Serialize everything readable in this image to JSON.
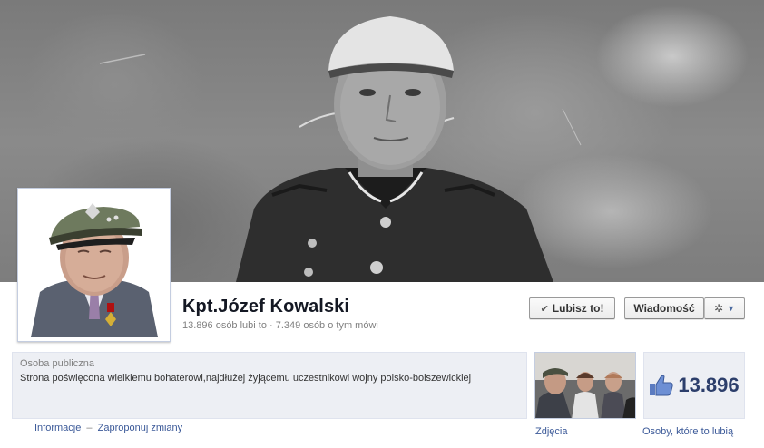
{
  "page": {
    "name": "Kpt.Józef Kowalski",
    "stats": "13.896 osób lubi to · 7.349 osób o tym mówi"
  },
  "actions": {
    "like_label": "Lubisz to!",
    "message_label": "Wiadomość"
  },
  "about": {
    "category": "Osoba publiczna",
    "description": "Strona poświęcona wielkiemu bohaterowi,najdłużej żyjącemu uczestnikowi wojny polsko-bolszewickiej",
    "info_link": "Informacje",
    "separator": "–",
    "suggest_link": "Zaproponuj zmiany"
  },
  "tiles": {
    "photos_label": "Zdjęcia",
    "likes_count": "13.896",
    "likes_label": "Osoby, które to lubią"
  },
  "icons": {
    "like": "thumbs-up-icon",
    "check": "checkmark-icon",
    "gear": "gear-icon",
    "caret": "caret-down-icon"
  },
  "colors": {
    "link": "#3b5998",
    "info_bg": "#edeff4",
    "likes_count": "#2c3e6b"
  }
}
